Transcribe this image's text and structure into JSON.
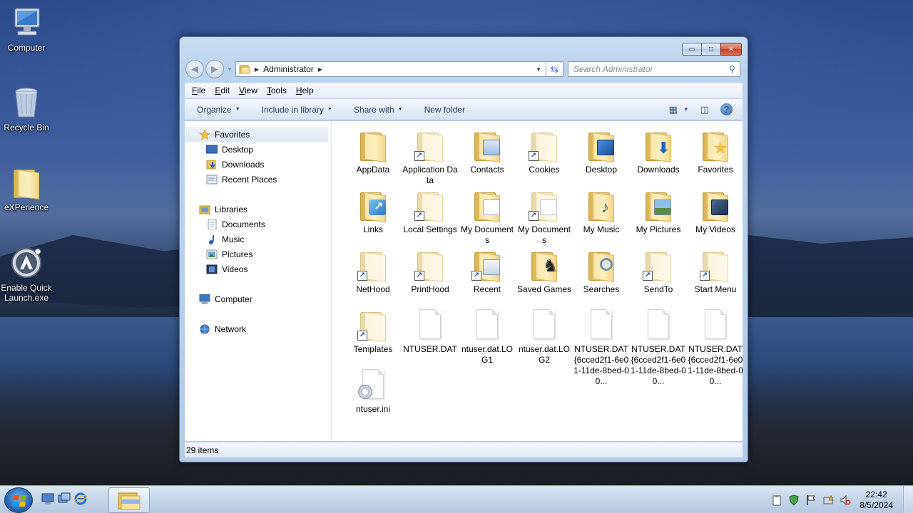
{
  "desktop": {
    "icons": [
      {
        "label": "Computer",
        "icon": "computer-icon"
      },
      {
        "label": "Recycle Bin",
        "icon": "recycle-bin-icon"
      },
      {
        "label": "eXPerience",
        "icon": "folder-icon"
      },
      {
        "label": "Enable Quick Launch.exe",
        "icon": "app-icon"
      }
    ]
  },
  "window": {
    "controls": {
      "minimize": "▭",
      "maximize": "□",
      "close": "✕"
    },
    "address": {
      "crumb": "Administrator"
    },
    "search": {
      "placeholder": "Search Administrator"
    },
    "menu": [
      {
        "label": "File",
        "key": "F",
        "rest": "ile"
      },
      {
        "label": "Edit",
        "key": "E",
        "rest": "dit"
      },
      {
        "label": "View",
        "key": "V",
        "rest": "iew"
      },
      {
        "label": "Tools",
        "key": "T",
        "rest": "ools"
      },
      {
        "label": "Help",
        "key": "H",
        "rest": "elp"
      }
    ],
    "commands": [
      {
        "label": "Organize",
        "dropdown": true
      },
      {
        "label": "Include in library",
        "dropdown": true
      },
      {
        "label": "Share with",
        "dropdown": true
      },
      {
        "label": "New folder",
        "dropdown": false
      }
    ],
    "navpane": {
      "favorites": {
        "label": "Favorites",
        "items": [
          "Desktop",
          "Downloads",
          "Recent Places"
        ]
      },
      "libraries": {
        "label": "Libraries",
        "items": [
          "Documents",
          "Music",
          "Pictures",
          "Videos"
        ]
      },
      "computer": "Computer",
      "network": "Network"
    },
    "files": [
      {
        "name": "AppData",
        "kind": "folder",
        "style": "plain"
      },
      {
        "name": "Application Data",
        "kind": "folder",
        "style": "shortcut-pale"
      },
      {
        "name": "Contacts",
        "kind": "folder",
        "style": "contacts"
      },
      {
        "name": "Cookies",
        "kind": "folder",
        "style": "shortcut-pale"
      },
      {
        "name": "Desktop",
        "kind": "folder",
        "style": "desktop"
      },
      {
        "name": "Downloads",
        "kind": "folder",
        "style": "downloads"
      },
      {
        "name": "Favorites",
        "kind": "folder",
        "style": "favorites"
      },
      {
        "name": "Links",
        "kind": "folder",
        "style": "links"
      },
      {
        "name": "Local Settings",
        "kind": "folder",
        "style": "shortcut-pale"
      },
      {
        "name": "My Documents",
        "kind": "folder",
        "style": "documents"
      },
      {
        "name": "My Documents",
        "kind": "folder",
        "style": "shortcut-doc"
      },
      {
        "name": "My Music",
        "kind": "folder",
        "style": "music"
      },
      {
        "name": "My Pictures",
        "kind": "folder",
        "style": "pictures"
      },
      {
        "name": "My Videos",
        "kind": "folder",
        "style": "videos"
      },
      {
        "name": "NetHood",
        "kind": "folder",
        "style": "shortcut-pale"
      },
      {
        "name": "PrintHood",
        "kind": "folder",
        "style": "shortcut-pale"
      },
      {
        "name": "Recent",
        "kind": "folder",
        "style": "recent"
      },
      {
        "name": "Saved Games",
        "kind": "folder",
        "style": "games"
      },
      {
        "name": "Searches",
        "kind": "folder",
        "style": "searches"
      },
      {
        "name": "SendTo",
        "kind": "folder",
        "style": "shortcut-pale"
      },
      {
        "name": "Start Menu",
        "kind": "folder",
        "style": "shortcut-pale"
      },
      {
        "name": "Templates",
        "kind": "folder",
        "style": "shortcut-pale"
      },
      {
        "name": "NTUSER.DAT",
        "kind": "file",
        "style": "blank"
      },
      {
        "name": "ntuser.dat.LOG1",
        "kind": "file",
        "style": "blank"
      },
      {
        "name": "ntuser.dat.LOG2",
        "kind": "file",
        "style": "blank"
      },
      {
        "name": "NTUSER.DAT{6cced2f1-6e01-11de-8bed-00...",
        "kind": "file",
        "style": "blank"
      },
      {
        "name": "NTUSER.DAT{6cced2f1-6e01-11de-8bed-00...",
        "kind": "file",
        "style": "blank"
      },
      {
        "name": "NTUSER.DAT{6cced2f1-6e01-11de-8bed-00...",
        "kind": "file",
        "style": "blank"
      },
      {
        "name": "ntuser.ini",
        "kind": "file",
        "style": "settings"
      }
    ],
    "status": "29 items"
  },
  "taskbar": {
    "clock": {
      "time": "22:42",
      "date": "8/5/2024"
    }
  },
  "colors": {
    "accent": "#3d73b8",
    "folder": "#f1d98a",
    "close": "#c4432c"
  }
}
